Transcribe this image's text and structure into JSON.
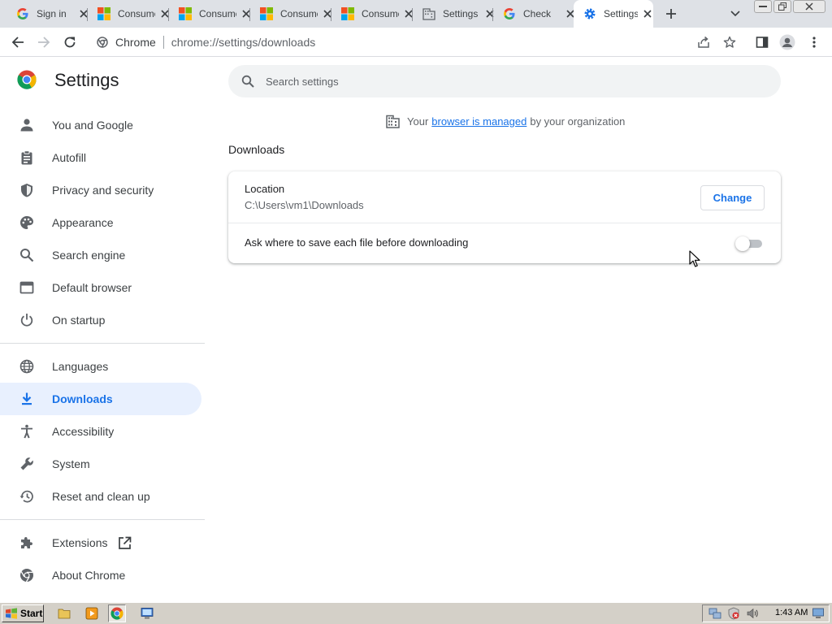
{
  "browser": {
    "tabs": [
      {
        "title": "Sign in",
        "favicon": "google-icon",
        "active": false
      },
      {
        "title": "Consumer",
        "favicon": "microsoft-icon",
        "active": false
      },
      {
        "title": "Consumer",
        "favicon": "microsoft-icon",
        "active": false
      },
      {
        "title": "Consumer",
        "favicon": "microsoft-icon",
        "active": false
      },
      {
        "title": "Consumer",
        "favicon": "microsoft-icon",
        "active": false
      },
      {
        "title": "Settings",
        "favicon": "building-icon",
        "active": false
      },
      {
        "title": "Check",
        "favicon": "google-icon",
        "active": false
      },
      {
        "title": "Settings",
        "favicon": "settings-gear-icon",
        "active": true
      }
    ],
    "omnibox": {
      "site_label": "Chrome",
      "url": "chrome://settings/downloads"
    }
  },
  "settings": {
    "title": "Settings",
    "search_placeholder": "Search settings",
    "nav_group1": [
      {
        "label": "You and Google",
        "icon": "person-icon"
      },
      {
        "label": "Autofill",
        "icon": "clipboard-icon"
      },
      {
        "label": "Privacy and security",
        "icon": "shield-icon"
      },
      {
        "label": "Appearance",
        "icon": "palette-icon"
      },
      {
        "label": "Search engine",
        "icon": "search-icon"
      },
      {
        "label": "Default browser",
        "icon": "browser-window-icon"
      },
      {
        "label": "On startup",
        "icon": "power-icon"
      }
    ],
    "nav_group2": [
      {
        "label": "Languages",
        "icon": "globe-icon"
      },
      {
        "label": "Downloads",
        "icon": "download-icon",
        "active": true
      },
      {
        "label": "Accessibility",
        "icon": "accessibility-icon"
      },
      {
        "label": "System",
        "icon": "wrench-icon"
      },
      {
        "label": "Reset and clean up",
        "icon": "history-icon"
      }
    ],
    "nav_group3": [
      {
        "label": "Extensions",
        "icon": "puzzle-icon"
      },
      {
        "label": "About Chrome",
        "icon": "chrome-icon"
      }
    ],
    "managed_notice": {
      "prefix": "Your",
      "link": "browser is managed",
      "suffix": "by your organization"
    },
    "section_title": "Downloads",
    "location_label": "Location",
    "location_value": "C:\\Users\\vm1\\Downloads",
    "change_button": "Change",
    "ask_label": "Ask where to save each file before downloading",
    "ask_enabled": false
  },
  "taskbar": {
    "start_label": "Start",
    "clock": "1:43 AM"
  },
  "colors": {
    "accent": "#1a73e8",
    "active_nav_bg": "#e8f0fe",
    "tabstrip_bg": "#dee1e6",
    "taskbar_bg": "#d4d0c8"
  }
}
